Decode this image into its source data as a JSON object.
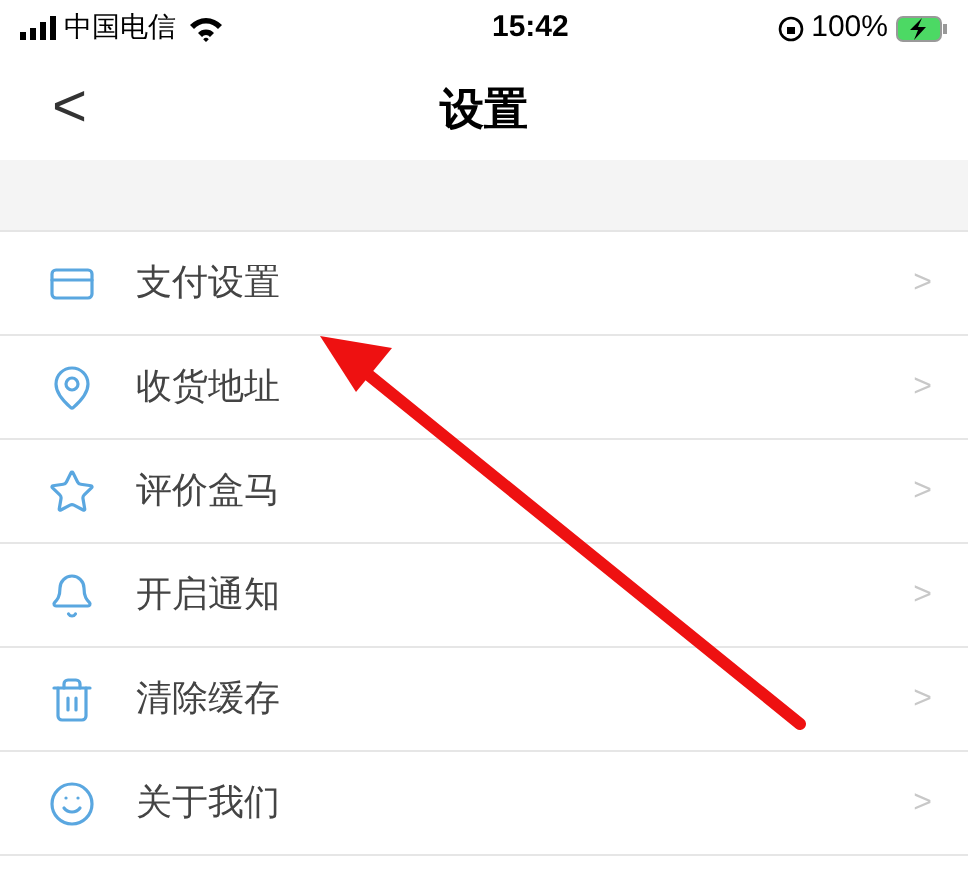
{
  "status_bar": {
    "carrier": "中国电信",
    "time": "15:42",
    "battery": "100%"
  },
  "nav": {
    "back": "<",
    "title": "设置"
  },
  "rows": [
    {
      "label": "支付设置",
      "chevron": ">"
    },
    {
      "label": "收货地址",
      "chevron": ">"
    },
    {
      "label": "评价盒马",
      "chevron": ">"
    },
    {
      "label": "开启通知",
      "chevron": ">"
    },
    {
      "label": "清除缓存",
      "chevron": ">"
    },
    {
      "label": "关于我们",
      "chevron": ">"
    }
  ]
}
